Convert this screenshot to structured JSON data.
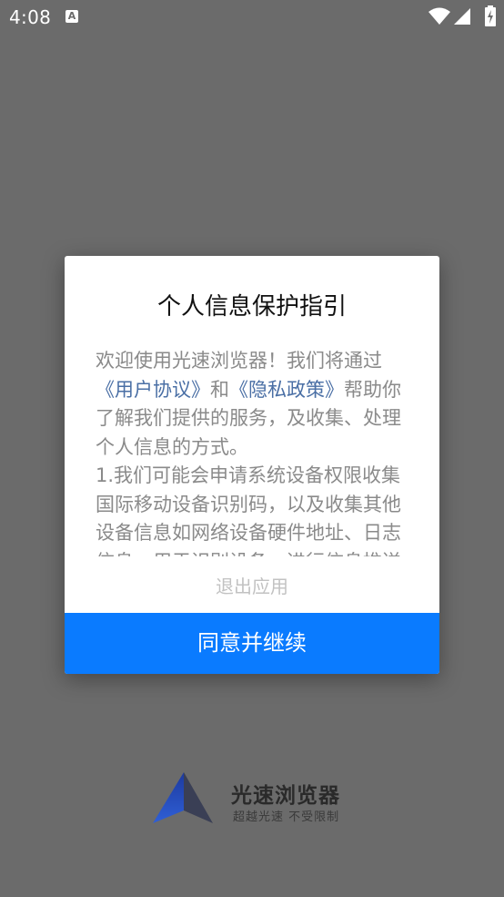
{
  "status_bar": {
    "time": "4:08",
    "notification_icon_letter": "A"
  },
  "dialog": {
    "title": "个人信息保护指引",
    "intro_prefix": "欢迎使用光速浏览器！我们将通过",
    "user_agreement_link": "《用户协议》",
    "and_text": "和",
    "privacy_policy_link": "《隐私政策》",
    "intro_suffix": "帮助你了解我们提供的服务，及收集、处理个人信息的方式。",
    "item_1": "1.我们可能会申请系统设备权限收集国际移动设备识别码，以及收集其他设备信息如网络设备硬件地址、日志信息，用于识别设备，进行信息推送",
    "exit_label": "退出应用",
    "agree_label": "同意并继续"
  },
  "brand": {
    "name": "光速浏览器",
    "tagline": "超越光速  不受限制"
  },
  "colors": {
    "overlay": "#6b6b6b",
    "accent": "#0a7bff",
    "link": "#4a6fa5"
  }
}
